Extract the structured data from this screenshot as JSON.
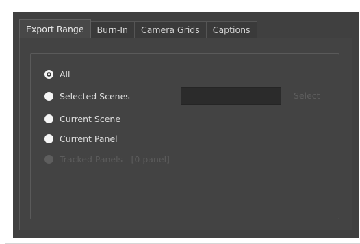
{
  "tabs": [
    {
      "label": "Export Range",
      "active": true
    },
    {
      "label": "Burn-In",
      "active": false
    },
    {
      "label": "Camera Grids",
      "active": false
    },
    {
      "label": "Captions",
      "active": false
    }
  ],
  "range": {
    "options": [
      {
        "label": "All",
        "checked": true,
        "enabled": true
      },
      {
        "label": "Selected Scenes",
        "checked": false,
        "enabled": true
      },
      {
        "label": "Current Scene",
        "checked": false,
        "enabled": true
      },
      {
        "label": "Current Panel",
        "checked": false,
        "enabled": true
      },
      {
        "label": "Tracked Panels - [0 panel]",
        "checked": false,
        "enabled": false
      }
    ],
    "selected_scenes_value": "",
    "select_label": "Select"
  },
  "colors": {
    "dialog_bg": "#404040",
    "pane_bg": "#434343",
    "field_bg": "#2b2b2b",
    "text": "#dcdcdc",
    "disabled_text": "#5c5c5c"
  }
}
